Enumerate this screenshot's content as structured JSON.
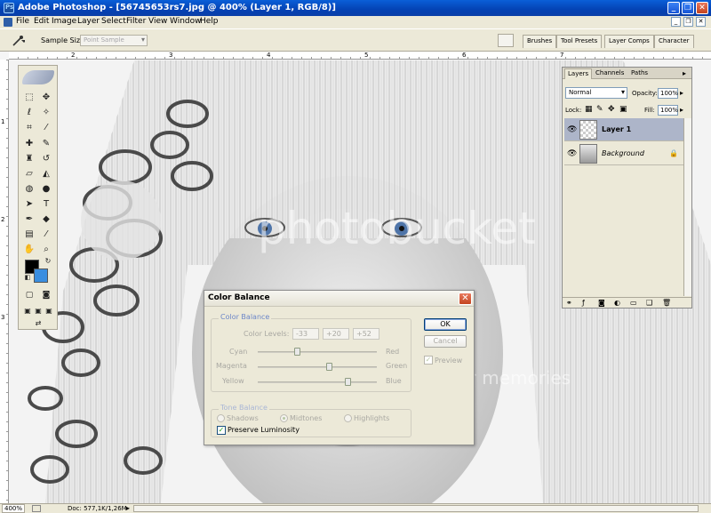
{
  "window": {
    "title": "Adobe Photoshop - [56745653rs7.jpg @ 400% (Layer 1, RGB/8)]",
    "minimize": "_",
    "maximize": "❐",
    "close": "✕"
  },
  "menu": {
    "items": [
      "File",
      "Edit",
      "Image",
      "Layer",
      "Select",
      "Filter",
      "View",
      "Window",
      "Help"
    ],
    "doc_controls": [
      "_",
      "❐",
      "✕"
    ]
  },
  "options_bar": {
    "sample_size_label": "Sample Size:",
    "sample_size_value": "Point Sample",
    "palette_tabs": [
      "Brushes",
      "Tool Presets",
      "Layer Comps",
      "Character"
    ]
  },
  "rulers": {
    "top": [
      "2",
      "3",
      "4",
      "5",
      "6",
      "7"
    ],
    "left": [
      "1",
      "2",
      "3"
    ]
  },
  "canvas": {
    "watermark_main": "photobucket",
    "watermark_sub": "Protect more of your memories"
  },
  "toolbox": {
    "tools": [
      {
        "icon": "marquee-icon",
        "glyph": "⬚"
      },
      {
        "icon": "move-icon",
        "glyph": "✥"
      },
      {
        "icon": "lasso-icon",
        "glyph": "ℓ"
      },
      {
        "icon": "magic-wand-icon",
        "glyph": "✧"
      },
      {
        "icon": "crop-icon",
        "glyph": "⌗"
      },
      {
        "icon": "slice-icon",
        "glyph": "⁄"
      },
      {
        "icon": "healing-brush-icon",
        "glyph": "✚"
      },
      {
        "icon": "brush-icon",
        "glyph": "✎"
      },
      {
        "icon": "clone-stamp-icon",
        "glyph": "♜"
      },
      {
        "icon": "history-brush-icon",
        "glyph": "↺"
      },
      {
        "icon": "eraser-icon",
        "glyph": "▱"
      },
      {
        "icon": "paint-bucket-icon",
        "glyph": "◭"
      },
      {
        "icon": "blur-icon",
        "glyph": "◍"
      },
      {
        "icon": "dodge-icon",
        "glyph": "●"
      },
      {
        "icon": "path-select-icon",
        "glyph": "➤"
      },
      {
        "icon": "type-icon",
        "glyph": "T"
      },
      {
        "icon": "pen-icon",
        "glyph": "✒"
      },
      {
        "icon": "shape-icon",
        "glyph": "◆"
      },
      {
        "icon": "notes-icon",
        "glyph": "▤"
      },
      {
        "icon": "eyedropper-icon",
        "glyph": "⁄"
      },
      {
        "icon": "hand-icon",
        "glyph": "✋"
      },
      {
        "icon": "zoom-icon",
        "glyph": "⌕"
      }
    ],
    "foreground_color": "#000000",
    "background_color": "#3A8EE0"
  },
  "layers_panel": {
    "tabs": [
      "Layers",
      "Channels",
      "Paths"
    ],
    "blend_mode": "Normal",
    "opacity_label": "Opacity:",
    "opacity_value": "100%",
    "lock_label": "Lock:",
    "fill_label": "Fill:",
    "fill_value": "100%",
    "layers": [
      {
        "name": "Layer 1",
        "selected": true
      },
      {
        "name": "Background",
        "selected": false
      }
    ]
  },
  "color_balance": {
    "title": "Color Balance",
    "group_title": "Color Balance",
    "levels_label": "Color Levels:",
    "levels": [
      "-33",
      "+20",
      "+52"
    ],
    "sliders": [
      {
        "left": "Cyan",
        "right": "Red",
        "value": -33
      },
      {
        "left": "Magenta",
        "right": "Green",
        "value": 20
      },
      {
        "left": "Yellow",
        "right": "Blue",
        "value": 52
      }
    ],
    "tone_title": "Tone Balance",
    "tones": [
      "Shadows",
      "Midtones",
      "Highlights"
    ],
    "selected_tone": "Midtones",
    "preserve_label": "Preserve Luminosity",
    "ok_label": "OK",
    "cancel_label": "Cancel",
    "preview_label": "Preview"
  },
  "statusbar": {
    "zoom": "400%",
    "doc_info": "Doc: 577,1K/1,26M",
    "arrow": "▸"
  }
}
